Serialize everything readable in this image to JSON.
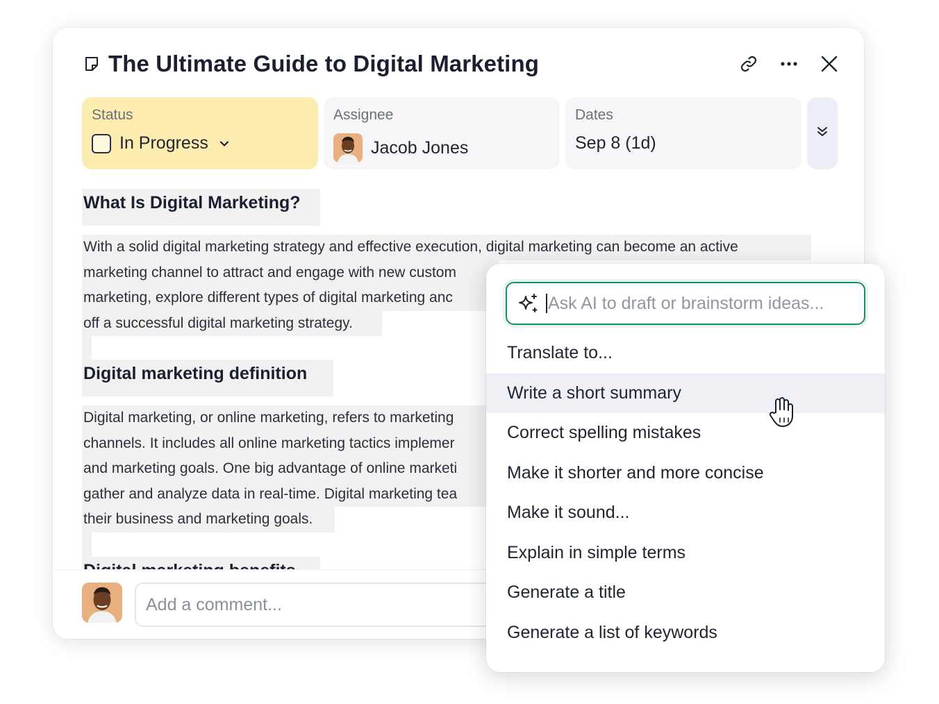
{
  "task": {
    "title": "The Ultimate Guide to Digital Marketing",
    "status_label": "Status",
    "status_value": "In Progress",
    "assignee_label": "Assignee",
    "assignee_name": "Jacob Jones",
    "dates_label": "Dates",
    "dates_value": "Sep 8 (1d)"
  },
  "doc": {
    "heading1": "What Is Digital Marketing?",
    "para1": [
      "With a solid digital marketing strategy and effective execution, digital marketing can become an active",
      "marketing channel to attract and engage with new custom",
      "marketing, explore different types of digital marketing anc",
      "off a successful digital marketing strategy."
    ],
    "heading2": "Digital marketing definition",
    "para2": [
      "Digital marketing, or online marketing, refers to marketing",
      "channels. It includes all online marketing tactics implemer",
      "and marketing goals. One big advantage of online marketi",
      "gather and analyze data in real-time. Digital marketing tea",
      "their business and marketing goals."
    ],
    "heading3": "Digital marketing benefits"
  },
  "comment": {
    "placeholder": "Add a comment..."
  },
  "ai_menu": {
    "placeholder": "Ask AI to draft or brainstorm ideas...",
    "items": [
      "Translate to...",
      "Write a short summary",
      "Correct spelling mistakes",
      "Make it shorter and more concise",
      "Make it sound...",
      "Explain in simple terms",
      "Generate a title",
      "Generate a list of keywords"
    ],
    "active_index": 1
  },
  "colors": {
    "status_bg": "#fdecb0",
    "ai_accent": "#1f8a6a",
    "highlight": "#f1f1f1",
    "active_item": "#eef0f6"
  },
  "icons": [
    "document-icon",
    "link-icon",
    "more-icon",
    "close-icon",
    "checkbox-icon",
    "chevron-down-icon",
    "expand-icon",
    "sparkle-icon",
    "hand-cursor-icon"
  ]
}
